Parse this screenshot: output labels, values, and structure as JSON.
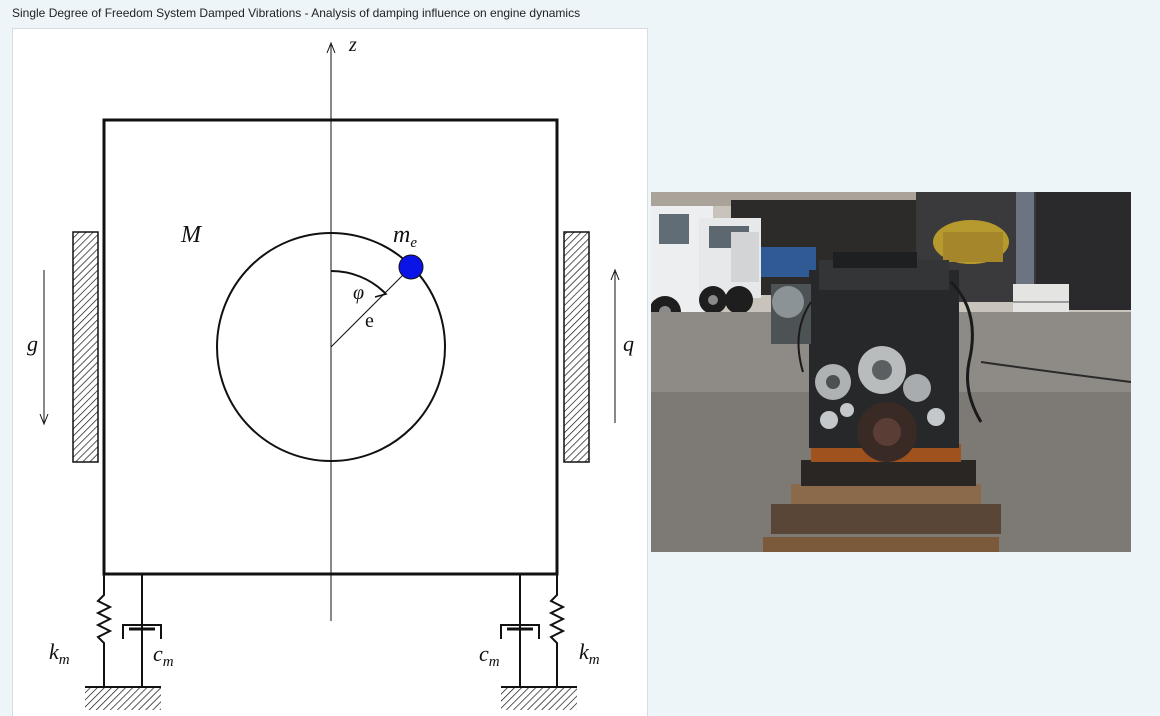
{
  "page": {
    "title": "Single Degree of Freedom System Damped Vibrations - Analysis of damping influence on engine dynamics"
  },
  "diagram": {
    "axis_label": "z",
    "body_mass_label": "M",
    "eccentric_mass_label": "m",
    "eccentric_mass_subscript": "e",
    "angle_label": "φ",
    "eccentricity_label": "e",
    "gravity_label": "g",
    "coordinate_label": "q",
    "spring_left_label": "k",
    "spring_left_subscript": "m",
    "spring_right_label": "k",
    "spring_right_subscript": "m",
    "damper_left_label": "c",
    "damper_left_subscript": "m",
    "damper_right_label": "c",
    "damper_right_subscript": "m",
    "eccentric_mass_color": "#0a14e6"
  },
  "photo": {
    "subject": "engine on wooden pallet in a truck yard"
  }
}
